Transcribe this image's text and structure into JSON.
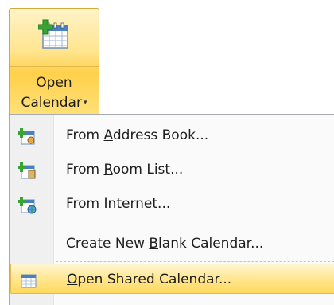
{
  "ribbon": {
    "button_line1": "Open",
    "button_line2": "Calendar",
    "dropdown_arrow": "▾"
  },
  "menu": {
    "items": [
      {
        "pre": "From ",
        "accel": "A",
        "post": "ddress Book...",
        "icon": "address-book-calendar-icon"
      },
      {
        "pre": "From ",
        "accel": "R",
        "post": "oom List...",
        "icon": "room-list-calendar-icon"
      },
      {
        "pre": "From ",
        "accel": "I",
        "post": "nternet...",
        "icon": "internet-calendar-icon"
      },
      {
        "pre": "Create New ",
        "accel": "B",
        "post": "lank Calendar...",
        "icon": ""
      },
      {
        "pre": "",
        "accel": "O",
        "post": "pen Shared Calendar...",
        "icon": "shared-calendar-icon"
      }
    ]
  },
  "colors": {
    "highlight": "#ffd95e",
    "calendar_green": "#3aa335",
    "calendar_blue": "#4a7fc1"
  }
}
